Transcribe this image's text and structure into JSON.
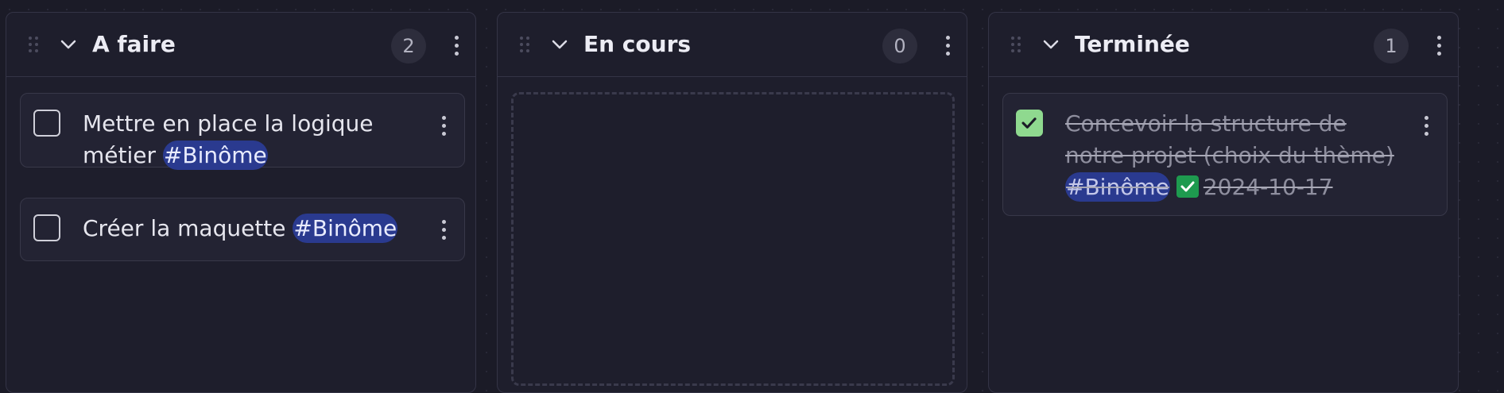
{
  "columns": [
    {
      "title": "A faire",
      "count": "2",
      "cards": [
        {
          "text": "Mettre en place la logique métier",
          "tag": "#Binôme",
          "checked": false
        },
        {
          "text": "Créer la maquette",
          "tag": "#Binôme",
          "checked": false
        }
      ]
    },
    {
      "title": "En cours",
      "count": "0",
      "cards": []
    },
    {
      "title": "Terminée",
      "count": "1",
      "cards": [
        {
          "text": "Concevoir la structure de notre projet (choix du thème)",
          "tag": "#Binôme",
          "done_date": "2024-10-17",
          "checked": true
        }
      ]
    }
  ],
  "icons": {
    "drag": "drag-handle-icon",
    "collapse": "chevron-down-icon",
    "menu": "more-vertical-icon",
    "done": "check-square-icon"
  },
  "colors": {
    "background": "#1b1b27",
    "column": "#1e1e2c",
    "card": "#232333",
    "tag": "#2a3a8f",
    "checked_box": "#8fd98f",
    "done_mark": "#1e9a4f"
  }
}
